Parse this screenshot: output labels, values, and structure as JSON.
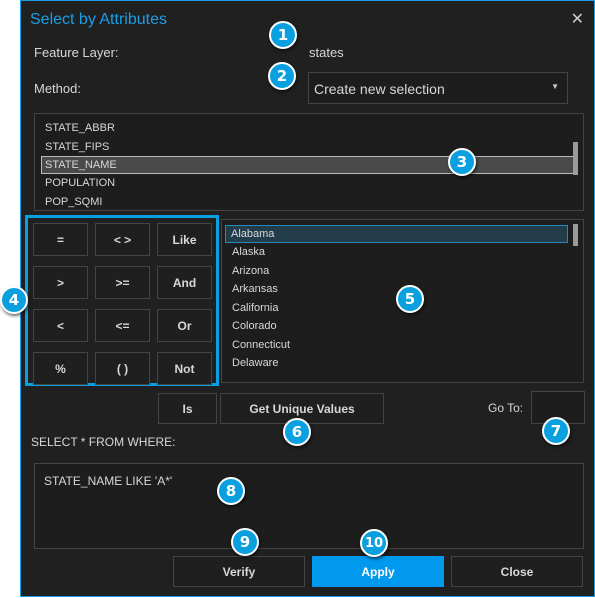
{
  "dialog": {
    "title": "Select by Attributes",
    "close_icon": "close-icon"
  },
  "feature_layer": {
    "label": "Feature Layer:",
    "value": "states"
  },
  "method": {
    "label": "Method:",
    "value": "Create new selection"
  },
  "fields": [
    "STATE_ABBR",
    "STATE_FIPS",
    "STATE_NAME",
    "POPULATION",
    "POP_SQMI"
  ],
  "selected_field": "STATE_NAME",
  "operators": [
    "=",
    "< >",
    "Like",
    ">",
    ">=",
    "And",
    "<",
    "<=",
    "Or",
    "%",
    "( )",
    "Not"
  ],
  "values": [
    "Alabama",
    "Alaska",
    "Arizona",
    "Arkansas",
    "California",
    "Colorado",
    "Connecticut",
    "Delaware"
  ],
  "selected_value": "Alabama",
  "is_label": "Is",
  "unique_label": "Get Unique Values",
  "goto_label": "Go To:",
  "goto_value": "",
  "sql_label": "SELECT * FROM WHERE:",
  "sql_text": "STATE_NAME  LIKE 'A*'",
  "buttons": {
    "verify": "Verify",
    "apply": "Apply",
    "close": "Close"
  },
  "badges": [
    "1",
    "2",
    "3",
    "4",
    "5",
    "6",
    "7",
    "8",
    "9",
    "10"
  ],
  "colors": {
    "accent": "#0aa0e0",
    "title": "#1a9ee6",
    "apply": "#0099ee"
  }
}
